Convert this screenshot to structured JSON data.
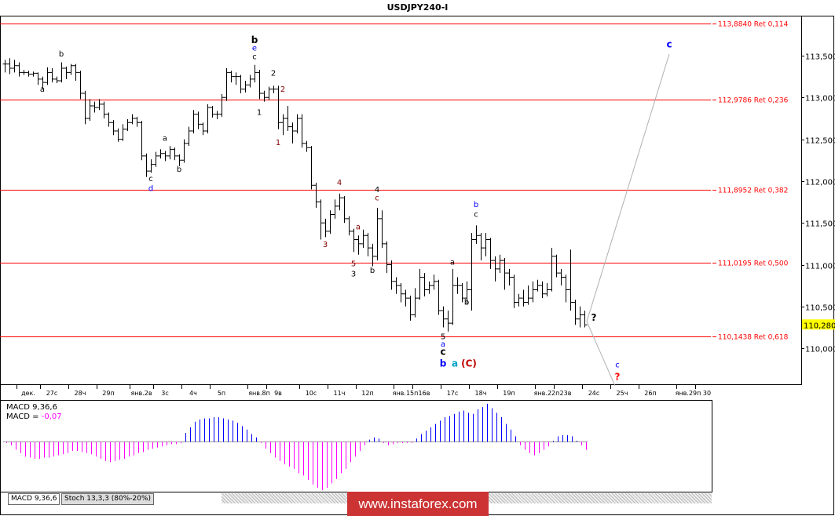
{
  "title": "USDJPY240-I",
  "chart_data": {
    "type": "ohlc",
    "symbol": "USDJPY240-I",
    "y_range": [
      109.55,
      113.95
    ],
    "y_ticks": [
      "113,500",
      "113,000",
      "112,500",
      "112,000",
      "111,500",
      "111,000",
      "110,500",
      "110,000"
    ],
    "y_tick_values": [
      113.5,
      113.0,
      112.5,
      112.0,
      111.5,
      111.0,
      110.5,
      110.0
    ],
    "current_price": {
      "label": "110,280",
      "value": 110.28,
      "color": "#ffff00"
    },
    "x_ticks": [
      {
        "label": "дек.",
        "bar": 5
      },
      {
        "label": "27с",
        "bar": 10
      },
      {
        "label": "28ч",
        "bar": 16
      },
      {
        "label": "29п",
        "bar": 22
      },
      {
        "label": "янв.2в",
        "bar": 29
      },
      {
        "label": "3с",
        "bar": 34
      },
      {
        "label": "4ч",
        "bar": 40
      },
      {
        "label": "5п",
        "bar": 46
      },
      {
        "label": "янв.8п",
        "bar": 54
      },
      {
        "label": "9в",
        "bar": 58
      },
      {
        "label": "10с",
        "bar": 65
      },
      {
        "label": "11ч",
        "bar": 71
      },
      {
        "label": "12п",
        "bar": 77
      },
      {
        "label": "янв.15п",
        "bar": 85
      },
      {
        "label": "16в",
        "bar": 89
      },
      {
        "label": "17с",
        "bar": 95
      },
      {
        "label": "18ч",
        "bar": 101
      },
      {
        "label": "19п",
        "bar": 107
      },
      {
        "label": "янв.22п",
        "bar": 115
      },
      {
        "label": "23в",
        "bar": 119
      },
      {
        "label": "24с",
        "bar": 125
      },
      {
        "label": "25ч",
        "bar": 131
      },
      {
        "label": "26п",
        "bar": 137
      },
      {
        "label": "янв.29п",
        "bar": 145
      },
      {
        "label": "30",
        "bar": 149
      }
    ],
    "bars_hlc": [
      [
        113.45,
        113.3,
        113.4
      ],
      [
        113.47,
        113.28,
        113.35
      ],
      [
        113.45,
        113.3,
        113.38
      ],
      [
        113.42,
        113.25,
        113.3
      ],
      [
        113.33,
        113.27,
        113.3
      ],
      [
        113.32,
        113.25,
        113.28
      ],
      [
        113.31,
        113.25,
        113.29
      ],
      [
        113.3,
        113.15,
        113.22
      ],
      [
        113.25,
        113.1,
        113.18
      ],
      [
        113.36,
        113.15,
        113.3
      ],
      [
        113.35,
        113.18,
        113.22
      ],
      [
        113.25,
        113.17,
        113.2
      ],
      [
        113.42,
        113.18,
        113.35
      ],
      [
        113.37,
        113.22,
        113.3
      ],
      [
        113.4,
        113.27,
        113.38
      ],
      [
        113.4,
        113.2,
        113.3
      ],
      [
        113.32,
        112.98,
        113.05
      ],
      [
        113.08,
        112.68,
        112.75
      ],
      [
        112.98,
        112.72,
        112.9
      ],
      [
        112.95,
        112.82,
        112.88
      ],
      [
        112.98,
        112.85,
        112.92
      ],
      [
        112.95,
        112.75,
        112.8
      ],
      [
        112.82,
        112.65,
        112.7
      ],
      [
        112.73,
        112.55,
        112.6
      ],
      [
        112.63,
        112.47,
        112.5
      ],
      [
        112.68,
        112.48,
        112.62
      ],
      [
        112.74,
        112.6,
        112.7
      ],
      [
        112.8,
        112.68,
        112.75
      ],
      [
        112.77,
        112.65,
        112.7
      ],
      [
        112.72,
        112.25,
        112.3
      ],
      [
        112.33,
        112.05,
        112.12
      ],
      [
        112.26,
        112.1,
        112.2
      ],
      [
        112.35,
        112.17,
        112.3
      ],
      [
        112.38,
        112.27,
        112.33
      ],
      [
        112.36,
        112.24,
        112.3
      ],
      [
        112.42,
        112.26,
        112.38
      ],
      [
        112.4,
        112.25,
        112.3
      ],
      [
        112.32,
        112.18,
        112.25
      ],
      [
        112.5,
        112.22,
        112.45
      ],
      [
        112.65,
        112.42,
        112.6
      ],
      [
        112.85,
        112.57,
        112.8
      ],
      [
        112.83,
        112.62,
        112.68
      ],
      [
        112.7,
        112.55,
        112.6
      ],
      [
        112.92,
        112.57,
        112.88
      ],
      [
        112.9,
        112.76,
        112.8
      ],
      [
        112.84,
        112.74,
        112.8
      ],
      [
        113.04,
        112.77,
        113.0
      ],
      [
        113.35,
        112.96,
        113.3
      ],
      [
        113.32,
        113.18,
        113.25
      ],
      [
        113.3,
        113.15,
        113.25
      ],
      [
        113.27,
        113.05,
        113.1
      ],
      [
        113.2,
        113.06,
        113.15
      ],
      [
        113.27,
        113.12,
        113.22
      ],
      [
        113.39,
        113.18,
        113.3
      ],
      [
        113.33,
        112.98,
        113.05
      ],
      [
        113.08,
        112.95,
        113.0
      ],
      [
        113.13,
        112.97,
        113.1
      ],
      [
        113.14,
        113.05,
        113.1
      ],
      [
        113.14,
        112.62,
        112.7
      ],
      [
        112.8,
        112.55,
        112.75
      ],
      [
        112.9,
        112.6,
        112.65
      ],
      [
        112.7,
        112.45,
        112.6
      ],
      [
        112.8,
        112.57,
        112.75
      ],
      [
        112.8,
        112.4,
        112.45
      ],
      [
        112.48,
        112.35,
        112.4
      ],
      [
        112.42,
        111.9,
        111.95
      ],
      [
        111.98,
        111.68,
        111.75
      ],
      [
        111.78,
        111.3,
        111.5
      ],
      [
        111.55,
        111.33,
        111.4
      ],
      [
        111.65,
        111.37,
        111.6
      ],
      [
        111.78,
        111.55,
        111.7
      ],
      [
        111.85,
        111.65,
        111.8
      ],
      [
        111.82,
        111.5,
        111.55
      ],
      [
        111.58,
        111.35,
        111.4
      ],
      [
        111.43,
        111.15,
        111.3
      ],
      [
        111.35,
        111.12,
        111.25
      ],
      [
        111.42,
        111.2,
        111.35
      ],
      [
        111.38,
        111.1,
        111.2
      ],
      [
        111.25,
        110.98,
        111.1
      ],
      [
        111.68,
        111.05,
        111.55
      ],
      [
        111.65,
        111.2,
        111.25
      ],
      [
        111.28,
        110.9,
        111.0
      ],
      [
        111.05,
        110.7,
        110.8
      ],
      [
        110.85,
        110.65,
        110.75
      ],
      [
        110.78,
        110.55,
        110.65
      ],
      [
        110.7,
        110.5,
        110.6
      ],
      [
        110.63,
        110.33,
        110.4
      ],
      [
        110.72,
        110.37,
        110.6
      ],
      [
        110.95,
        110.58,
        110.85
      ],
      [
        110.9,
        110.62,
        110.7
      ],
      [
        110.8,
        110.65,
        110.75
      ],
      [
        110.88,
        110.7,
        110.8
      ],
      [
        110.82,
        110.4,
        110.45
      ],
      [
        110.5,
        110.25,
        110.35
      ],
      [
        110.45,
        110.2,
        110.3
      ],
      [
        110.95,
        110.28,
        110.75
      ],
      [
        110.85,
        110.65,
        110.75
      ],
      [
        110.78,
        110.55,
        110.6
      ],
      [
        110.8,
        110.52,
        110.7
      ],
      [
        111.38,
        110.45,
        111.3
      ],
      [
        111.47,
        111.25,
        111.35
      ],
      [
        111.38,
        111.05,
        111.2
      ],
      [
        111.38,
        111.1,
        111.3
      ],
      [
        111.32,
        110.95,
        111.05
      ],
      [
        111.1,
        110.8,
        110.95
      ],
      [
        111.12,
        110.9,
        111.05
      ],
      [
        111.08,
        110.7,
        110.9
      ],
      [
        110.95,
        110.75,
        110.85
      ],
      [
        110.88,
        110.48,
        110.55
      ],
      [
        110.65,
        110.5,
        110.6
      ],
      [
        110.7,
        110.5,
        110.55
      ],
      [
        110.75,
        110.52,
        110.6
      ],
      [
        110.8,
        110.55,
        110.7
      ],
      [
        110.82,
        110.68,
        110.75
      ],
      [
        110.8,
        110.6,
        110.65
      ],
      [
        110.78,
        110.62,
        110.7
      ],
      [
        111.2,
        110.68,
        111.1
      ],
      [
        111.12,
        110.85,
        110.9
      ],
      [
        110.95,
        110.75,
        110.85
      ],
      [
        110.88,
        110.55,
        110.7
      ],
      [
        111.18,
        110.45,
        110.55
      ],
      [
        110.58,
        110.28,
        110.35
      ],
      [
        110.5,
        110.25,
        110.4
      ],
      [
        110.45,
        110.25,
        110.28
      ]
    ],
    "fib_levels": [
      {
        "value": 113.884,
        "label": "113,8840 Ret 0,114"
      },
      {
        "value": 112.9786,
        "label": "112,9786 Ret 0,236"
      },
      {
        "value": 111.8952,
        "label": "111,8952 Ret 0,382"
      },
      {
        "value": 111.0195,
        "label": "111,0195 Ret 0,500"
      },
      {
        "value": 110.1438,
        "label": "110,1438 Ret 0,618"
      }
    ],
    "fib_color": "#ff0000",
    "wave_labels": [
      {
        "t": "a",
        "bar": 8,
        "p": 113.07,
        "c": "#000000"
      },
      {
        "t": "b",
        "bar": 12,
        "p": 113.49,
        "c": "#000000"
      },
      {
        "t": "b",
        "bar": 53,
        "p": 113.65,
        "c": "#000000",
        "bold": true
      },
      {
        "t": "e",
        "bar": 53,
        "p": 113.56,
        "c": "#0000ff"
      },
      {
        "t": "c",
        "bar": 53,
        "p": 113.46,
        "c": "#000000"
      },
      {
        "t": "c",
        "bar": 31,
        "p": 112.0,
        "c": "#000000"
      },
      {
        "t": "d",
        "bar": 31,
        "p": 111.88,
        "c": "#0000ff"
      },
      {
        "t": "a",
        "bar": 34,
        "p": 112.48,
        "c": "#000000"
      },
      {
        "t": "b",
        "bar": 37,
        "p": 112.11,
        "c": "#000000"
      },
      {
        "t": "2",
        "bar": 57,
        "p": 113.26,
        "c": "#000000"
      },
      {
        "t": "1",
        "bar": 54,
        "p": 112.79,
        "c": "#000000"
      },
      {
        "t": "2",
        "bar": 59,
        "p": 113.07,
        "c": "#800000"
      },
      {
        "t": "1",
        "bar": 58,
        "p": 112.43,
        "c": "#800000"
      },
      {
        "t": "4",
        "bar": 71,
        "p": 111.95,
        "c": "#800000"
      },
      {
        "t": "3",
        "bar": 68,
        "p": 111.21,
        "c": "#800000"
      },
      {
        "t": "a",
        "bar": 75,
        "p": 111.42,
        "c": "#800000"
      },
      {
        "t": "5",
        "bar": 74,
        "p": 110.98,
        "c": "#800000"
      },
      {
        "t": "3",
        "bar": 74,
        "p": 110.86,
        "c": "#000000"
      },
      {
        "t": "b",
        "bar": 78,
        "p": 110.9,
        "c": "#000000"
      },
      {
        "t": "4",
        "bar": 79,
        "p": 111.87,
        "c": "#000000"
      },
      {
        "t": "c",
        "bar": 79,
        "p": 111.77,
        "c": "#800000"
      },
      {
        "t": "a",
        "bar": 95,
        "p": 111.0,
        "c": "#000000"
      },
      {
        "t": "b",
        "bar": 98,
        "p": 110.52,
        "c": "#000000"
      },
      {
        "t": "b",
        "bar": 100,
        "p": 111.69,
        "c": "#0000ff"
      },
      {
        "t": "c",
        "bar": 100,
        "p": 111.57,
        "c": "#000000"
      },
      {
        "t": "5",
        "bar": 93,
        "p": 110.11,
        "c": "#000000"
      },
      {
        "t": "a",
        "bar": 93,
        "p": 110.02,
        "c": "#0000ff"
      },
      {
        "t": "c",
        "bar": 93,
        "p": 109.92,
        "c": "#000000",
        "bold": true
      },
      {
        "t": "b",
        "bar": 93,
        "p": 109.78,
        "c": "#0000ff",
        "bold": true
      },
      {
        "t": "a",
        "bar": 95.5,
        "p": 109.78,
        "c": "#00a0c8",
        "bold": true
      },
      {
        "t": "(C)",
        "bar": 98.5,
        "p": 109.78,
        "c": "#c00000",
        "bold": true
      },
      {
        "t": "?",
        "bar": 125,
        "p": 110.33,
        "c": "#000000",
        "bold": true
      },
      {
        "t": "c",
        "bar": 141,
        "p": 113.6,
        "c": "#0000ff",
        "bold": true
      },
      {
        "t": "c",
        "bar": 130,
        "p": 109.77,
        "c": "#0000ff"
      },
      {
        "t": "?",
        "bar": 130,
        "p": 109.62,
        "c": "#ff0000",
        "bold": true
      }
    ],
    "projections": [
      {
        "from": {
          "bar": 123.5,
          "p": 110.32
        },
        "to": {
          "bar": 141,
          "p": 113.52
        }
      },
      {
        "from": {
          "bar": 123.5,
          "p": 110.32
        },
        "to": {
          "bar": 129.5,
          "p": 109.55
        }
      }
    ]
  },
  "macd": {
    "name": "MACD 9,36,6",
    "value_label": "MACD = ",
    "value": "-0,07",
    "positive_color": "#0000ff",
    "negative_color": "#ff00ff",
    "histogram": [
      -0.01,
      -0.03,
      -0.07,
      -0.1,
      -0.13,
      -0.14,
      -0.15,
      -0.15,
      -0.14,
      -0.14,
      -0.13,
      -0.12,
      -0.11,
      -0.1,
      -0.08,
      -0.08,
      -0.09,
      -0.1,
      -0.11,
      -0.13,
      -0.15,
      -0.17,
      -0.18,
      -0.17,
      -0.16,
      -0.15,
      -0.13,
      -0.12,
      -0.1,
      -0.09,
      -0.07,
      -0.06,
      -0.05,
      -0.04,
      -0.03,
      -0.02,
      -0.02,
      -0.01,
      0.08,
      0.13,
      0.18,
      0.2,
      0.21,
      0.21,
      0.22,
      0.22,
      0.21,
      0.2,
      0.19,
      0.17,
      0.14,
      0.11,
      0.07,
      0.04,
      -0.01,
      -0.06,
      -0.1,
      -0.14,
      -0.17,
      -0.2,
      -0.22,
      -0.24,
      -0.28,
      -0.3,
      -0.34,
      -0.38,
      -0.41,
      -0.43,
      -0.41,
      -0.37,
      -0.33,
      -0.28,
      -0.24,
      -0.18,
      -0.13,
      -0.08,
      -0.03,
      0.02,
      0.04,
      0.03,
      -0.01,
      -0.03,
      -0.02,
      -0.01,
      -0.01,
      -0.01,
      -0.01,
      0.03,
      0.07,
      0.1,
      0.13,
      0.16,
      0.19,
      0.22,
      0.23,
      0.25,
      0.27,
      0.28,
      0.26,
      0.25,
      0.29,
      0.31,
      0.34,
      0.3,
      0.26,
      0.22,
      0.16,
      0.11,
      0.05,
      -0.03,
      -0.07,
      -0.1,
      -0.12,
      -0.1,
      -0.07,
      -0.04,
      0.01,
      0.05,
      0.06,
      0.06,
      0.05,
      0.01,
      -0.03,
      -0.07
    ]
  },
  "tabs": [
    "MACD 9,36,6",
    "Stoch 13,3,3 (80%-20%)"
  ],
  "watermark": "www.instaforex.com"
}
